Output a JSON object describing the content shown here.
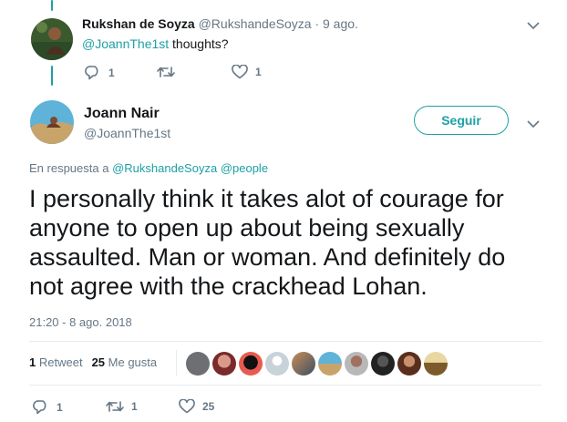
{
  "parent_tweet": {
    "author_name": "Rukshan de Soyza",
    "author_handle": "@RukshandeSoyza",
    "separator": "·",
    "date": "9 ago.",
    "mention": "@JoannThe1st",
    "text": " thoughts?",
    "reply_count": "1",
    "retweet_count": "",
    "like_count": "1"
  },
  "main_tweet": {
    "author_name": "Joann Nair",
    "author_handle": "@JoannThe1st",
    "follow_label": "Seguir",
    "reply_prefix": "En respuesta a",
    "reply_to_1": "@RukshandeSoyza",
    "reply_to_2": "@people",
    "text": "I personally think it takes alot of courage for anyone to open up about being sexually assaulted. Man or woman. And definitely do not agree with the crackhead Lohan.",
    "timestamp": "21:20 - 8 ago. 2018",
    "retweets_num": "1",
    "retweets_label": "Retweet",
    "likes_num": "25",
    "likes_label": "Me gusta",
    "reply_count": "1",
    "retweet_count": "1",
    "like_count": "25"
  },
  "colors": {
    "accent": "#1da1a5",
    "text": "#14171a",
    "muted": "#657786",
    "divider": "#e6ecf0"
  },
  "icons": {
    "reply": "reply-icon",
    "retweet": "retweet-icon",
    "like": "heart-icon",
    "menu": "chevron-down-icon"
  },
  "likers_count": 10
}
